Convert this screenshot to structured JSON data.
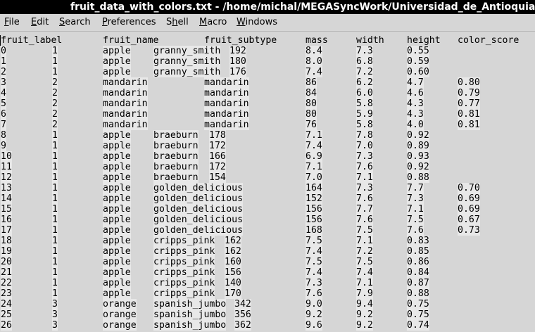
{
  "window": {
    "title": "fruit_data_with_colors.txt - /home/michal/MEGASyncWork/Universidad_de_Antioquia/CARGAS/Ca"
  },
  "menu": {
    "items": [
      {
        "label": "File",
        "mnemonic": "F",
        "rest": "ile"
      },
      {
        "label": "Edit",
        "mnemonic": "E",
        "rest": "dit"
      },
      {
        "label": "Search",
        "mnemonic": "S",
        "rest": "earch"
      },
      {
        "label": "Preferences",
        "mnemonic": "P",
        "rest": "references"
      },
      {
        "label": "Shell",
        "mnemonic": "h",
        "pre": "S",
        "rest": "ell"
      },
      {
        "label": "Macro",
        "mnemonic": "M",
        "rest": "acro"
      },
      {
        "label": "Windows",
        "mnemonic": "W",
        "rest": "indows"
      }
    ]
  },
  "table": {
    "header": [
      "fruit_label",
      "fruit_name",
      "fruit_subtype",
      "mass",
      "width",
      "height",
      "color_score"
    ],
    "rows": [
      {
        "idx": "0",
        "label": "1",
        "name": "apple",
        "subtype": "granny_smith",
        "mass": "192",
        "width": "8.4",
        "height": "7.3",
        "color": "0.55"
      },
      {
        "idx": "1",
        "label": "1",
        "name": "apple",
        "subtype": "granny_smith",
        "mass": "180",
        "width": "8.0",
        "height": "6.8",
        "color": "0.59"
      },
      {
        "idx": "2",
        "label": "1",
        "name": "apple",
        "subtype": "granny_smith",
        "mass": "176",
        "width": "7.4",
        "height": "7.2",
        "color": "0.60"
      },
      {
        "idx": "3",
        "label": "2",
        "name": "mandarin",
        "subtype": "mandarin",
        "mass": "86",
        "width": "6.2",
        "height": "4.7",
        "color": "0.80"
      },
      {
        "idx": "4",
        "label": "2",
        "name": "mandarin",
        "subtype": "mandarin",
        "mass": "84",
        "width": "6.0",
        "height": "4.6",
        "color": "0.79"
      },
      {
        "idx": "5",
        "label": "2",
        "name": "mandarin",
        "subtype": "mandarin",
        "mass": "80",
        "width": "5.8",
        "height": "4.3",
        "color": "0.77"
      },
      {
        "idx": "6",
        "label": "2",
        "name": "mandarin",
        "subtype": "mandarin",
        "mass": "80",
        "width": "5.9",
        "height": "4.3",
        "color": "0.81"
      },
      {
        "idx": "7",
        "label": "2",
        "name": "mandarin",
        "subtype": "mandarin",
        "mass": "76",
        "width": "5.8",
        "height": "4.0",
        "color": "0.81"
      },
      {
        "idx": "8",
        "label": "1",
        "name": "apple",
        "subtype": "braeburn",
        "mass": "178",
        "width": "7.1",
        "height": "7.8",
        "color": "0.92"
      },
      {
        "idx": "9",
        "label": "1",
        "name": "apple",
        "subtype": "braeburn",
        "mass": "172",
        "width": "7.4",
        "height": "7.0",
        "color": "0.89"
      },
      {
        "idx": "10",
        "label": "1",
        "name": "apple",
        "subtype": "braeburn",
        "mass": "166",
        "width": "6.9",
        "height": "7.3",
        "color": "0.93"
      },
      {
        "idx": "11",
        "label": "1",
        "name": "apple",
        "subtype": "braeburn",
        "mass": "172",
        "width": "7.1",
        "height": "7.6",
        "color": "0.92"
      },
      {
        "idx": "12",
        "label": "1",
        "name": "apple",
        "subtype": "braeburn",
        "mass": "154",
        "width": "7.0",
        "height": "7.1",
        "color": "0.88"
      },
      {
        "idx": "13",
        "label": "1",
        "name": "apple",
        "subtype": "golden_delicious",
        "mass": "164",
        "width": "7.3",
        "height": "7.7",
        "color": "0.70"
      },
      {
        "idx": "14",
        "label": "1",
        "name": "apple",
        "subtype": "golden_delicious",
        "mass": "152",
        "width": "7.6",
        "height": "7.3",
        "color": "0.69"
      },
      {
        "idx": "15",
        "label": "1",
        "name": "apple",
        "subtype": "golden_delicious",
        "mass": "156",
        "width": "7.7",
        "height": "7.1",
        "color": "0.69"
      },
      {
        "idx": "16",
        "label": "1",
        "name": "apple",
        "subtype": "golden_delicious",
        "mass": "156",
        "width": "7.6",
        "height": "7.5",
        "color": "0.67"
      },
      {
        "idx": "17",
        "label": "1",
        "name": "apple",
        "subtype": "golden_delicious",
        "mass": "168",
        "width": "7.5",
        "height": "7.6",
        "color": "0.73"
      },
      {
        "idx": "18",
        "label": "1",
        "name": "apple",
        "subtype": "cripps_pink",
        "mass": "162",
        "width": "7.5",
        "height": "7.1",
        "color": "0.83"
      },
      {
        "idx": "19",
        "label": "1",
        "name": "apple",
        "subtype": "cripps_pink",
        "mass": "162",
        "width": "7.4",
        "height": "7.2",
        "color": "0.85"
      },
      {
        "idx": "20",
        "label": "1",
        "name": "apple",
        "subtype": "cripps_pink",
        "mass": "160",
        "width": "7.5",
        "height": "7.5",
        "color": "0.86"
      },
      {
        "idx": "21",
        "label": "1",
        "name": "apple",
        "subtype": "cripps_pink",
        "mass": "156",
        "width": "7.4",
        "height": "7.4",
        "color": "0.84"
      },
      {
        "idx": "22",
        "label": "1",
        "name": "apple",
        "subtype": "cripps_pink",
        "mass": "140",
        "width": "7.3",
        "height": "7.1",
        "color": "0.87"
      },
      {
        "idx": "23",
        "label": "1",
        "name": "apple",
        "subtype": "cripps_pink",
        "mass": "170",
        "width": "7.6",
        "height": "7.9",
        "color": "0.88"
      },
      {
        "idx": "24",
        "label": "3",
        "name": "orange",
        "subtype": "spanish_jumbo",
        "mass": "342",
        "width": "9.0",
        "height": "9.4",
        "color": "0.75"
      },
      {
        "idx": "25",
        "label": "3",
        "name": "orange",
        "subtype": "spanish_jumbo",
        "mass": "356",
        "width": "9.2",
        "height": "9.2",
        "color": "0.75"
      },
      {
        "idx": "26",
        "label": "3",
        "name": "orange",
        "subtype": "spanish_jumbo",
        "mass": "362",
        "width": "9.6",
        "height": "9.2",
        "color": "0.74"
      }
    ]
  }
}
